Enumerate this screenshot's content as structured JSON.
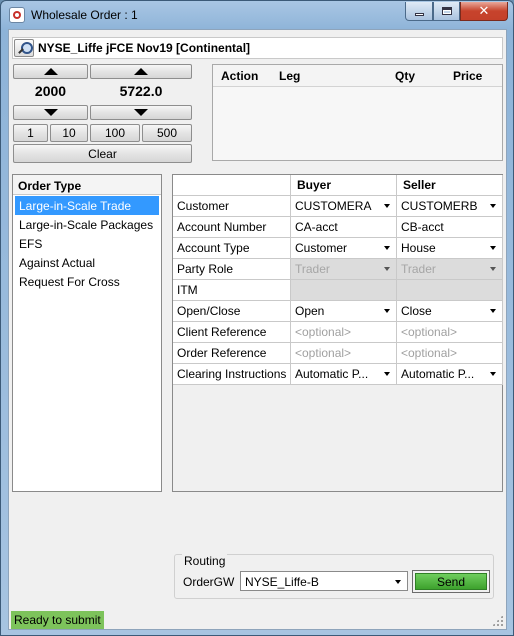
{
  "window": {
    "title": "Wholesale Order : 1",
    "minimize_icon": "minimize-icon",
    "maximize_icon": "maximize-icon",
    "close_icon": "close-icon",
    "close_color": "#c7432c"
  },
  "instrument": {
    "search_icon": "search-icon",
    "name": "NYSE_Liffe jFCE Nov19 [Continental]"
  },
  "quantity": {
    "value": "2000"
  },
  "price": {
    "value": "5722.0"
  },
  "increments": [
    "1",
    "10",
    "100",
    "500"
  ],
  "clear_label": "Clear",
  "legs_table": {
    "columns": [
      "Action",
      "Leg",
      "Qty",
      "Price"
    ],
    "rows": []
  },
  "order_type": {
    "header": "Order Type",
    "items": [
      "Large-in-Scale Trade",
      "Large-in-Scale Packages",
      "EFS",
      "Against Actual",
      "Request For Cross"
    ],
    "selected": "Large-in-Scale Trade",
    "selected_color": "#3399ff"
  },
  "form": {
    "headers": {
      "field": "",
      "buyer": "Buyer",
      "seller": "Seller"
    },
    "rows": [
      {
        "label": "Customer",
        "buyer": "CUSTOMERA",
        "seller": "CUSTOMERB"
      },
      {
        "label": "Account Number",
        "buyer": "CA-acct",
        "seller": "CB-acct"
      },
      {
        "label": "Account Type",
        "buyer": "Customer",
        "seller": "House"
      },
      {
        "label": "Party Role",
        "buyer": "Trader",
        "seller": "Trader"
      },
      {
        "label": "ITM",
        "buyer": "",
        "seller": ""
      },
      {
        "label": "Open/Close",
        "buyer": "Open",
        "seller": "Close"
      },
      {
        "label": "Client Reference",
        "buyer": "<optional>",
        "seller": "<optional>"
      },
      {
        "label": "Order Reference",
        "buyer": "<optional>",
        "seller": "<optional>"
      },
      {
        "label": "Clearing Instructions",
        "buyer": "Automatic P...",
        "seller": "Automatic P..."
      }
    ]
  },
  "routing": {
    "legend": "Routing",
    "ordergw_label": "OrderGW",
    "ordergw_value": "NYSE_Liffe-B",
    "send_label": "Send",
    "send_color": "#4caf3a"
  },
  "status": {
    "text": "Ready to submit",
    "color": "#7dc35b"
  }
}
